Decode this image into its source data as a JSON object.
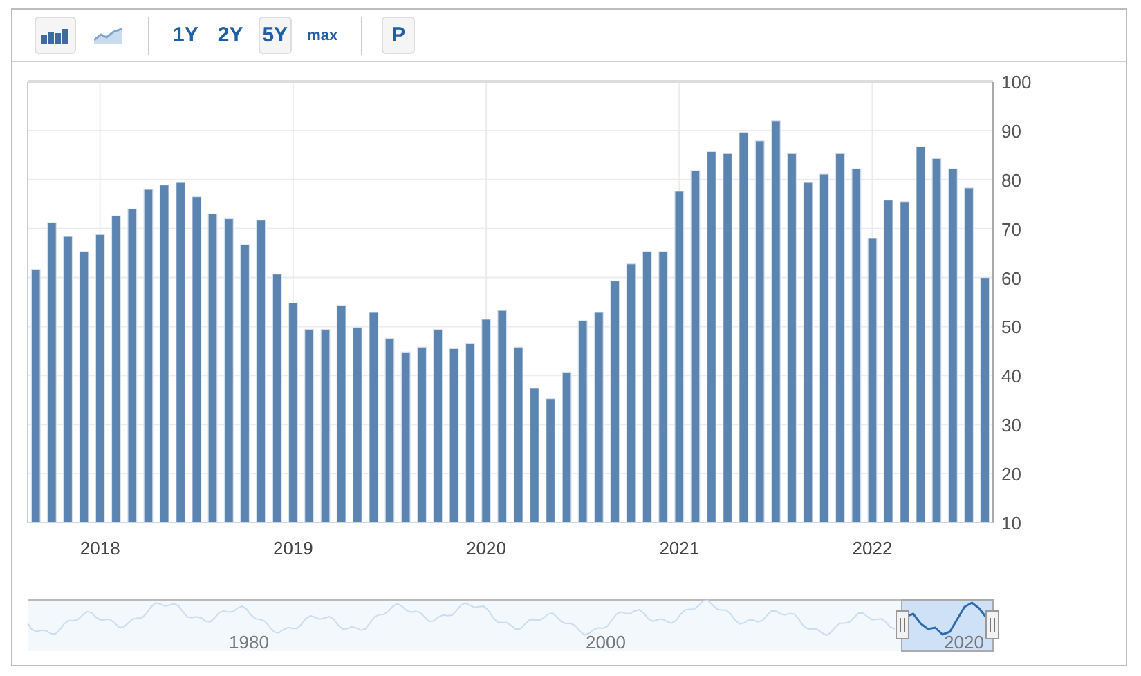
{
  "toolbar": {
    "chart_types": [
      {
        "kind": "bar",
        "selected": true
      },
      {
        "kind": "area",
        "selected": false
      }
    ],
    "ranges": [
      {
        "label": "1Y",
        "selected": false
      },
      {
        "label": "2Y",
        "selected": false
      },
      {
        "label": "5Y",
        "selected": true
      },
      {
        "label": "max",
        "selected": false
      }
    ],
    "print_button": "P"
  },
  "chart": {
    "chart_data": {
      "type": "bar",
      "x": [
        2017.667,
        2017.75,
        2017.833,
        2017.917,
        2018.0,
        2018.083,
        2018.167,
        2018.25,
        2018.333,
        2018.417,
        2018.5,
        2018.583,
        2018.667,
        2018.75,
        2018.833,
        2018.917,
        2019.0,
        2019.083,
        2019.167,
        2019.25,
        2019.333,
        2019.417,
        2019.5,
        2019.583,
        2019.667,
        2019.75,
        2019.833,
        2019.917,
        2020.0,
        2020.083,
        2020.167,
        2020.25,
        2020.333,
        2020.417,
        2020.5,
        2020.583,
        2020.667,
        2020.75,
        2020.833,
        2020.917,
        2021.0,
        2021.083,
        2021.167,
        2021.25,
        2021.333,
        2021.417,
        2021.5,
        2021.583,
        2021.667,
        2021.75,
        2021.833,
        2021.917,
        2022.0,
        2022.083,
        2022.167,
        2022.25,
        2022.333,
        2022.417,
        2022.5,
        2022.583
      ],
      "values": [
        61.7,
        71.2,
        68.4,
        65.3,
        68.8,
        72.6,
        74.0,
        78.0,
        78.9,
        79.4,
        76.5,
        73.0,
        72.0,
        66.7,
        71.7,
        60.7,
        54.8,
        49.4,
        49.4,
        54.3,
        49.8,
        52.9,
        47.6,
        44.8,
        45.8,
        49.4,
        45.5,
        46.6,
        51.5,
        53.3,
        45.8,
        37.4,
        35.3,
        40.7,
        51.2,
        52.9,
        59.3,
        62.8,
        65.3,
        65.3,
        77.6,
        81.8,
        85.7,
        85.3,
        89.6,
        87.9,
        92.0,
        85.3,
        79.4,
        81.1,
        85.3,
        82.2,
        68.0,
        75.8,
        75.5,
        86.7,
        84.3,
        82.2,
        78.3,
        60.0
      ],
      "ylim": [
        10,
        100
      ],
      "yticks": [
        10,
        20,
        30,
        40,
        50,
        60,
        70,
        80,
        90,
        100
      ],
      "xlim": [
        2017.625,
        2022.625
      ],
      "xticks": [
        2018,
        2019,
        2020,
        2021,
        2022
      ],
      "grid": true
    }
  },
  "navigator": {
    "labels": [
      "1980",
      "2000",
      "2020"
    ]
  }
}
